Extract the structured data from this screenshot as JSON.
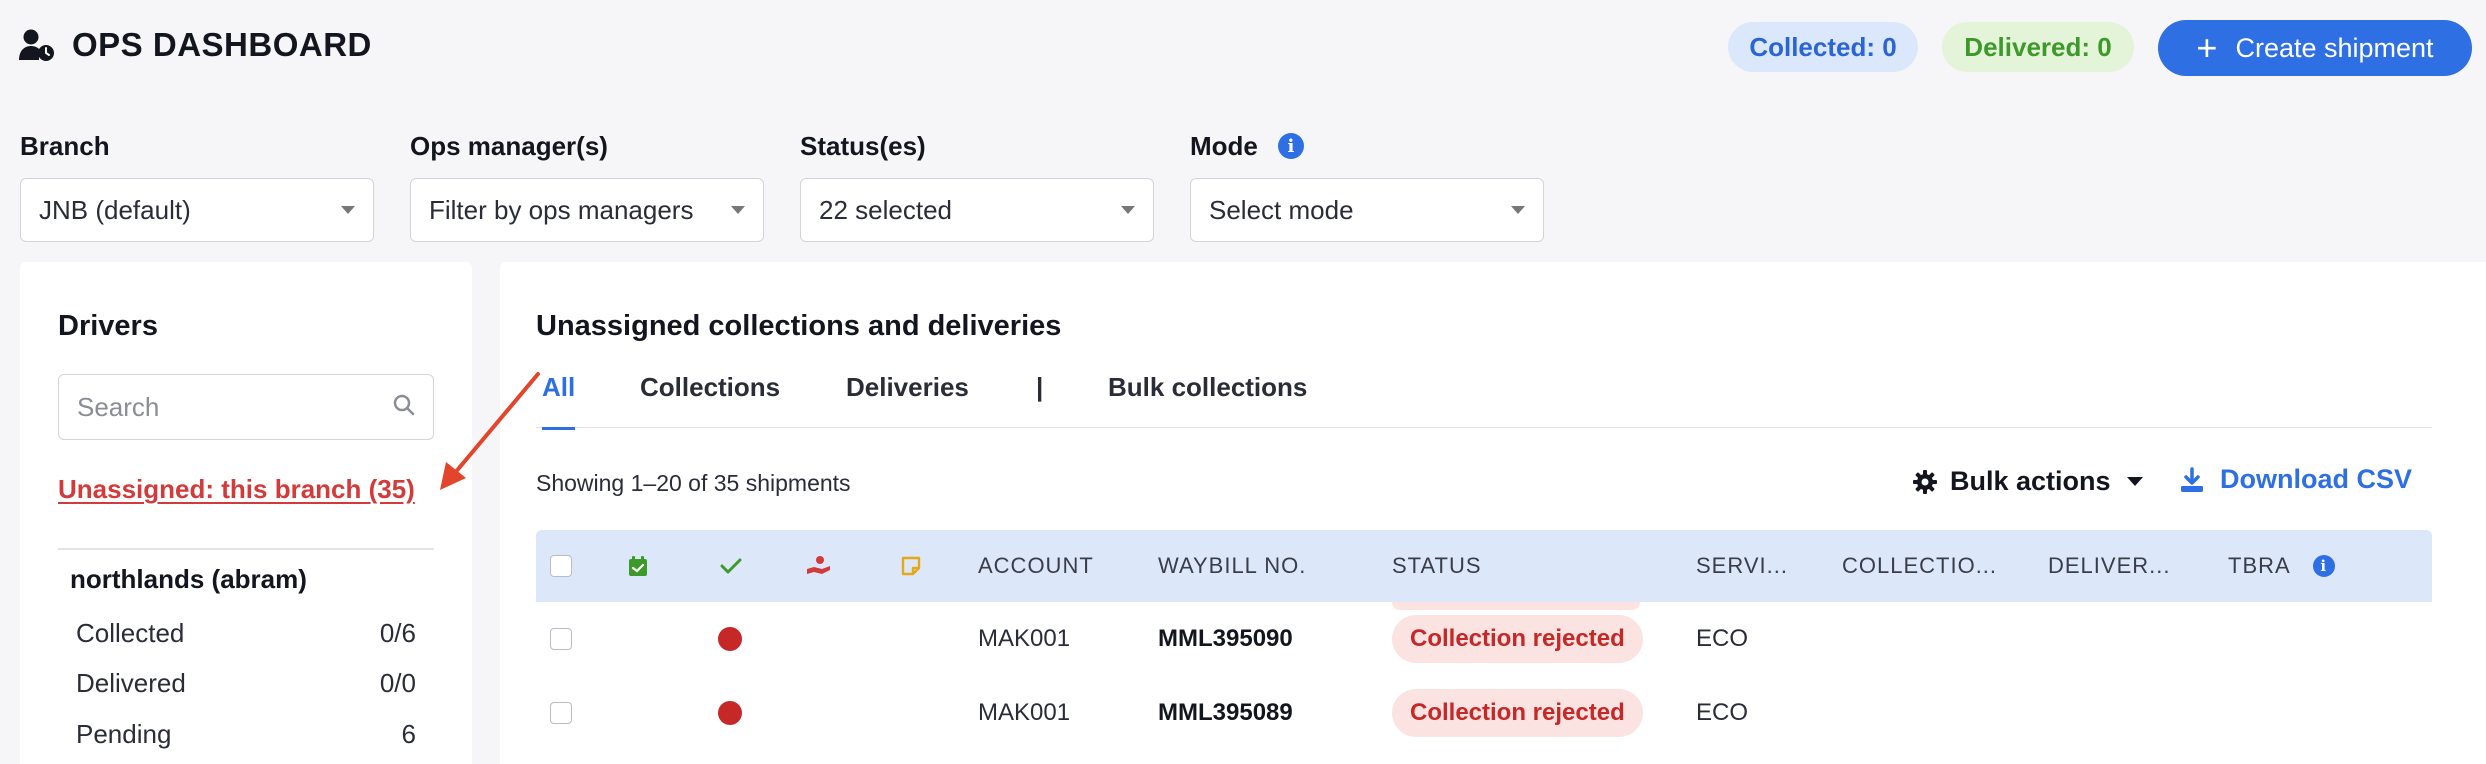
{
  "header": {
    "title": "OPS DASHBOARD",
    "collected_badge": "Collected: 0",
    "delivered_badge": "Delivered: 0",
    "create_button": "Create shipment"
  },
  "filters": {
    "branch": {
      "label": "Branch",
      "value": "JNB (default)"
    },
    "ops_managers": {
      "label": "Ops manager(s)",
      "value": "Filter by ops managers"
    },
    "statuses": {
      "label": "Status(es)",
      "value": "22 selected"
    },
    "mode": {
      "label": "Mode",
      "value": "Select mode"
    }
  },
  "drivers": {
    "title": "Drivers",
    "search_placeholder": "Search",
    "unassigned_link": "Unassigned: this branch (35)",
    "driver": {
      "name": "northlands (abram)",
      "stats": [
        {
          "label": "Collected",
          "value": "0/6"
        },
        {
          "label": "Delivered",
          "value": "0/0"
        },
        {
          "label": "Pending",
          "value": "6"
        }
      ]
    }
  },
  "main": {
    "title": "Unassigned collections and deliveries",
    "tabs": [
      {
        "label": "All",
        "active": true
      },
      {
        "label": "Collections",
        "active": false
      },
      {
        "label": "Deliveries",
        "active": false
      },
      {
        "label": "|",
        "active": false
      },
      {
        "label": "Bulk collections",
        "active": false
      }
    ],
    "showing": "Showing 1–20 of 35 shipments",
    "bulk_actions": "Bulk actions",
    "download_csv": "Download CSV",
    "columns": {
      "account": "ACCOUNT",
      "waybill": "WAYBILL NO.",
      "status": "STATUS",
      "service": "SERVI...",
      "collection": "COLLECTIO...",
      "delivery": "DELIVER...",
      "tbra": "TBRA"
    },
    "rows": [
      {
        "account": "MAK001",
        "waybill": "MML395090",
        "status": "Collection rejected",
        "service": "ECO"
      },
      {
        "account": "MAK001",
        "waybill": "MML395089",
        "status": "Collection rejected",
        "service": "ECO"
      }
    ]
  },
  "colors": {
    "accent": "#2f6fe4",
    "danger": "#c62828",
    "header_row": "#dce8fa"
  }
}
